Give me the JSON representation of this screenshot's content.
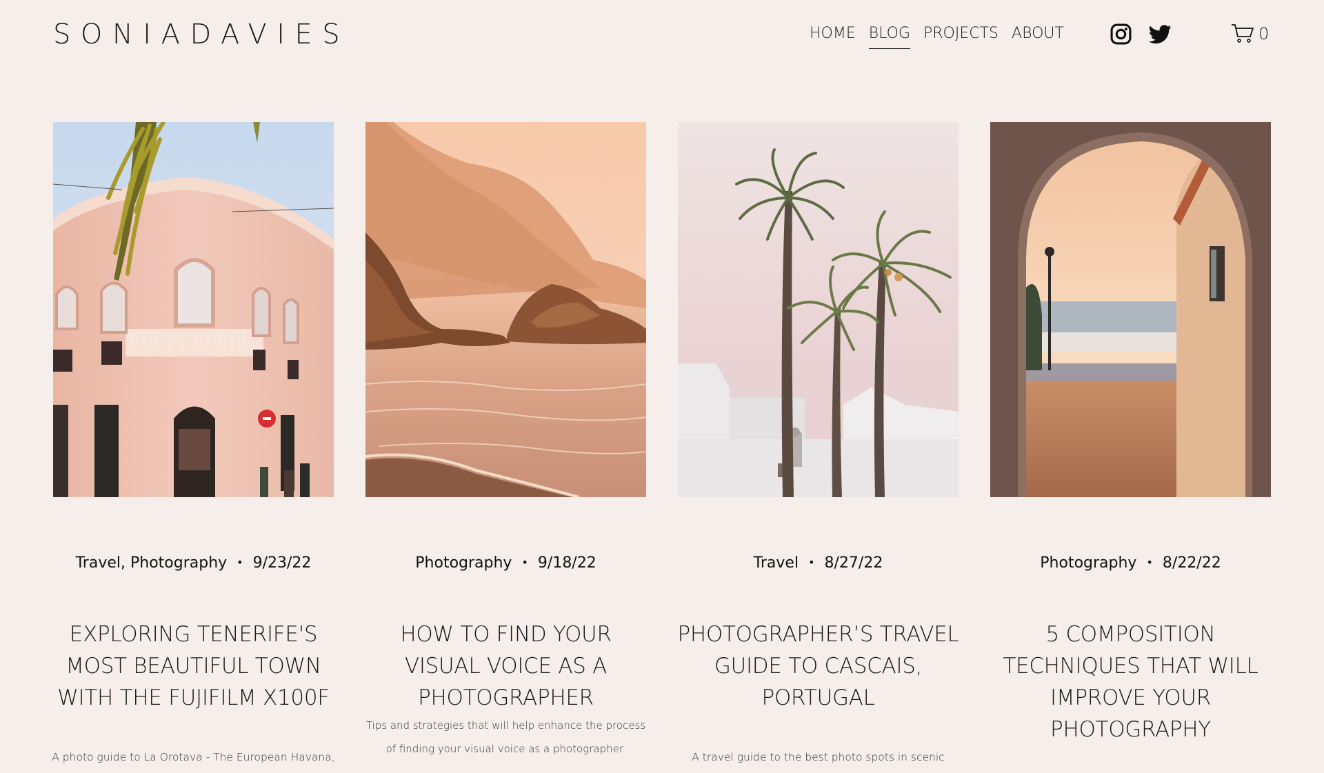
{
  "header": {
    "logo": "SONIADAVIES",
    "nav": [
      {
        "label": "HOME",
        "active": false
      },
      {
        "label": "BLOG",
        "active": true
      },
      {
        "label": "PROJECTS",
        "active": false
      },
      {
        "label": "ABOUT",
        "active": false
      }
    ],
    "social_icons": [
      "instagram-icon",
      "twitter-icon"
    ],
    "cart_icon": "cart-icon",
    "cart_count": "0"
  },
  "posts": [
    {
      "categories": "Travel, Photography",
      "date": "9/23/22",
      "title": "EXPLORING TENERIFE'S MOST BEAUTIFUL TOWN WITH THE FUJIFILM X100F",
      "excerpt": "A photo guide to La Orotava - The European Havana,",
      "image": "pink-colonial-building-with-palm"
    },
    {
      "categories": "Photography",
      "date": "9/18/22",
      "title": "HOW TO FIND YOUR VISUAL VOICE AS A PHOTOGRAPHER",
      "excerpt": "Tips and strategies that will help enhance the process of finding your visual voice as a photographer.",
      "image": "golden-coastal-cliffs"
    },
    {
      "categories": "Travel",
      "date": "8/27/22",
      "title": "PHOTOGRAPHER’S TRAVEL GUIDE TO CASCAIS, PORTUGAL",
      "excerpt": "A travel guide to the best photo spots in scenic Cascais,",
      "image": "palm-trees-pink-sky"
    },
    {
      "categories": "Photography",
      "date": "8/22/22",
      "title": "5 COMPOSITION TECHNIQUES THAT WILL IMPROVE YOUR PHOTOGRAPHY",
      "excerpt": "",
      "image": "stone-archway-sea-view"
    }
  ],
  "colors": {
    "background": "#f6eeea",
    "text": "#1a1a1a"
  }
}
